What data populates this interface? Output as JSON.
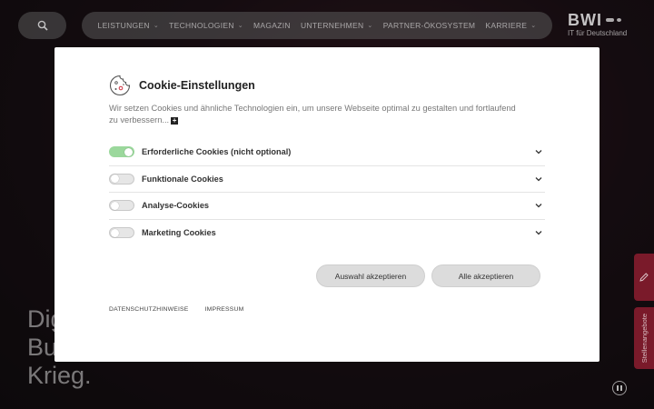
{
  "nav": {
    "items": [
      {
        "label": "LEISTUNGEN",
        "dropdown": true
      },
      {
        "label": "TECHNOLOGIEN",
        "dropdown": true
      },
      {
        "label": "MAGAZIN",
        "dropdown": false
      },
      {
        "label": "UNTERNEHMEN",
        "dropdown": true
      },
      {
        "label": "PARTNER-ÖKOSYSTEM",
        "dropdown": false
      },
      {
        "label": "KARRIERE",
        "dropdown": true
      }
    ]
  },
  "logo": {
    "mark": "BWI",
    "tagline": "IT für Deutschland"
  },
  "hero": {
    "lines": [
      "Dig",
      "Bu",
      "Krieg."
    ]
  },
  "side_tabs": {
    "tab2_label": "Stellenangebote"
  },
  "modal": {
    "title": "Cookie-Einstellungen",
    "description": "Wir setzen Cookies und ähnliche Technologien ein, um unsere Webseite optimal zu gestalten und fortlaufend zu verbessern...",
    "more_symbol": "+",
    "categories": [
      {
        "label": "Erforderliche Cookies (nicht optional)",
        "enabled": true
      },
      {
        "label": "Funktionale Cookies",
        "enabled": false
      },
      {
        "label": "Analyse-Cookies",
        "enabled": false
      },
      {
        "label": "Marketing Cookies",
        "enabled": false
      }
    ],
    "accept_selection_label": "Auswahl akzeptieren",
    "accept_all_label": "Alle akzeptieren",
    "footer_links": [
      "DATENSCHUTZHINWEISE",
      "IMPRESSUM"
    ]
  },
  "colors": {
    "toggle_on": "#9bd89c",
    "side_tab": "#7a1a2a"
  }
}
